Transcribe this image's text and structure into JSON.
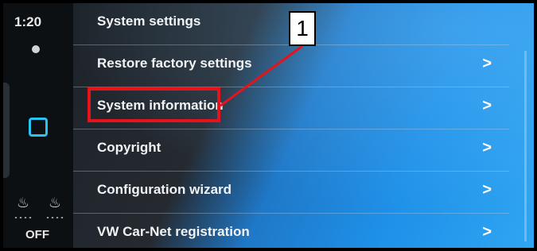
{
  "sidebar": {
    "time": "1:20",
    "climate": "OFF",
    "icons": [
      "status-icon",
      "home-icon",
      "seat-heat-driver-icon",
      "seat-heat-passenger-icon"
    ]
  },
  "menu": {
    "items": [
      {
        "label": "System settings",
        "chevron": ""
      },
      {
        "label": "Restore factory settings",
        "chevron": ">"
      },
      {
        "label": "System information",
        "chevron": ">"
      },
      {
        "label": "Copyright",
        "chevron": ">"
      },
      {
        "label": "Configuration wizard",
        "chevron": ">"
      },
      {
        "label": "VW Car-Net registration",
        "chevron": ">"
      }
    ]
  },
  "annotation": {
    "callout_number": "1",
    "highlight_color": "#e8121b"
  }
}
